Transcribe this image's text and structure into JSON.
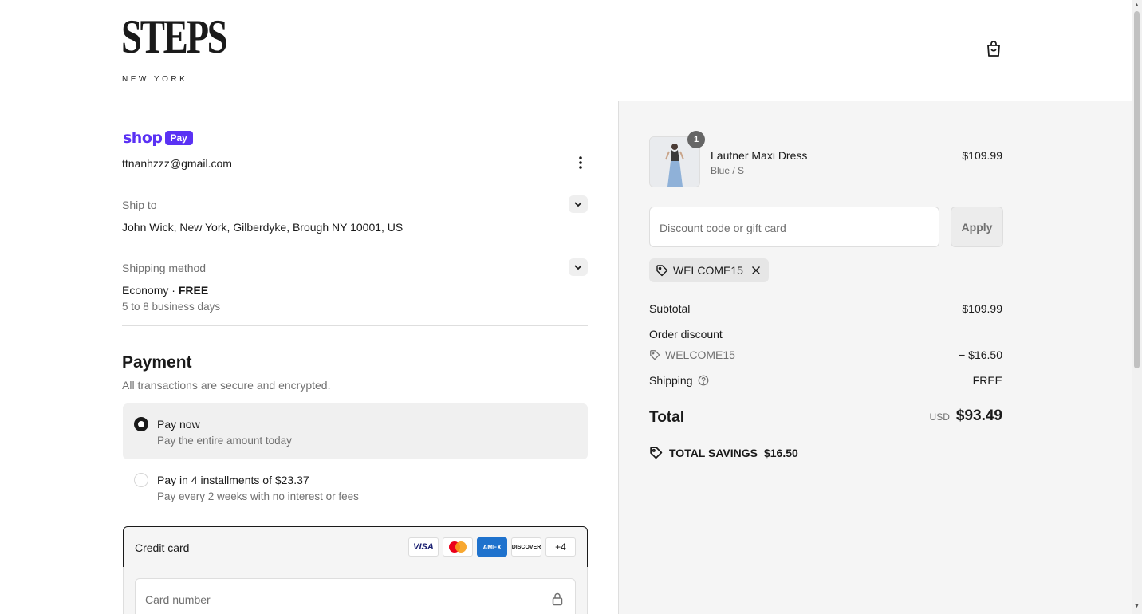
{
  "brand": {
    "logo_main": "STEPS",
    "logo_sub": "NEW YORK"
  },
  "header": {
    "cart_icon": "shopping-bag-icon"
  },
  "express": {
    "shop_word": "shop",
    "pay_badge": "Pay",
    "email": "ttnanhzzz@gmail.com"
  },
  "ship_to": {
    "label": "Ship to",
    "value": "John Wick, New York, Gilberdyke, Brough NY 10001, US"
  },
  "shipping_method": {
    "label": "Shipping method",
    "name": "Economy",
    "separator": " · ",
    "price": "FREE",
    "eta": "5 to 8 business days"
  },
  "payment": {
    "title": "Payment",
    "subtitle": "All transactions are secure and encrypted.",
    "options": [
      {
        "title": "Pay now",
        "subtitle": "Pay the entire amount today",
        "selected": true
      },
      {
        "title": "Pay in 4 installments of $23.37",
        "subtitle": "Pay every 2 weeks with no interest or fees",
        "selected": false
      }
    ],
    "credit_card": {
      "label": "Credit card",
      "logos": [
        "VISA",
        "mastercard",
        "AMEX",
        "DISCOVER"
      ],
      "more": "+4",
      "card_number_placeholder": "Card number"
    }
  },
  "summary": {
    "product": {
      "name": "Lautner Maxi Dress",
      "variant": "Blue / S",
      "price": "$109.99",
      "quantity": "1"
    },
    "discount_placeholder": "Discount code or gift card",
    "apply_label": "Apply",
    "applied_code": "WELCOME15",
    "subtotal_label": "Subtotal",
    "subtotal_value": "$109.99",
    "order_discount_label": "Order discount",
    "discount_code": "WELCOME15",
    "discount_value": "− $16.50",
    "shipping_label": "Shipping",
    "shipping_value": "FREE",
    "total_label": "Total",
    "currency": "USD",
    "total_value": "$93.49",
    "savings_label": "TOTAL SAVINGS",
    "savings_value": "$16.50"
  }
}
